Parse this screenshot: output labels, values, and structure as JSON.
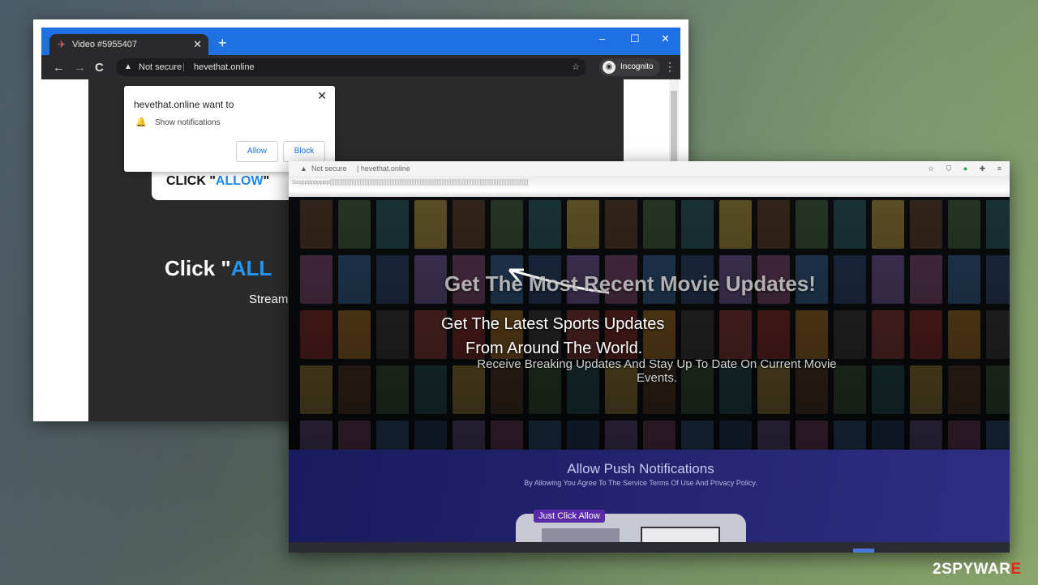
{
  "window1": {
    "tab_title": "Video #5955407",
    "new_tab": "+",
    "controls": {
      "minimize": "–",
      "maximize": "☐",
      "close": "✕"
    },
    "nav": {
      "back": "←",
      "forward": "→",
      "reload": "C"
    },
    "omnibox": {
      "warning": "▲",
      "not_secure": "Not secure",
      "separator": "|",
      "url": "hevethat.online",
      "star": "☆"
    },
    "incognito_label": "Incognito",
    "menu": "⋮",
    "permission": {
      "title": "hevethat.online want to",
      "item": "Show notifications",
      "allow": "Allow",
      "block": "Block",
      "close": "✕"
    },
    "click_prefix": "CLICK \"",
    "click_allow": "ALLOW",
    "click_suffix": "\"",
    "big_prefix": "Click \"",
    "big_allow": "ALL",
    "stream": "Stream"
  },
  "window2": {
    "address": {
      "warning": "▲",
      "not_secure": "Not secure",
      "url": "| hevethat.online"
    },
    "strip_text": "Sssppppppppp[[[[[[[[[[[[[[[[[[[[[[[[[[[[[[[[[[[[[[[[[[[[[[[[[[[[[[[[[[[[[[[[[[[[[[[[[[[[[[[[[[[[[[[[[[[[[[[[[[[[[[[[[[[[[[[[[[[[[[[[[[[[[[",
    "headline_movie": "Get The Most Recent Movie Updates!",
    "headline_sports": "Get The Latest Sports Updates",
    "headline_world": "From Around The World.",
    "receive_text": "Receive Breaking Updates And Stay Up To Date On Current Movie Events.",
    "push_title": "Allow Push Notifications",
    "push_sub": "By Allowing You Agree To The Service Terms Of Use And Privacy Policy.",
    "just_click": "Just Click Allow"
  },
  "watermark": {
    "prefix": "2",
    "mid": "SPYWAR",
    "suffix": "E"
  },
  "colors": {
    "chrome_blue": "#1f6fe5",
    "allow_blue": "#2196f3",
    "purple": "#5b2aa6"
  }
}
